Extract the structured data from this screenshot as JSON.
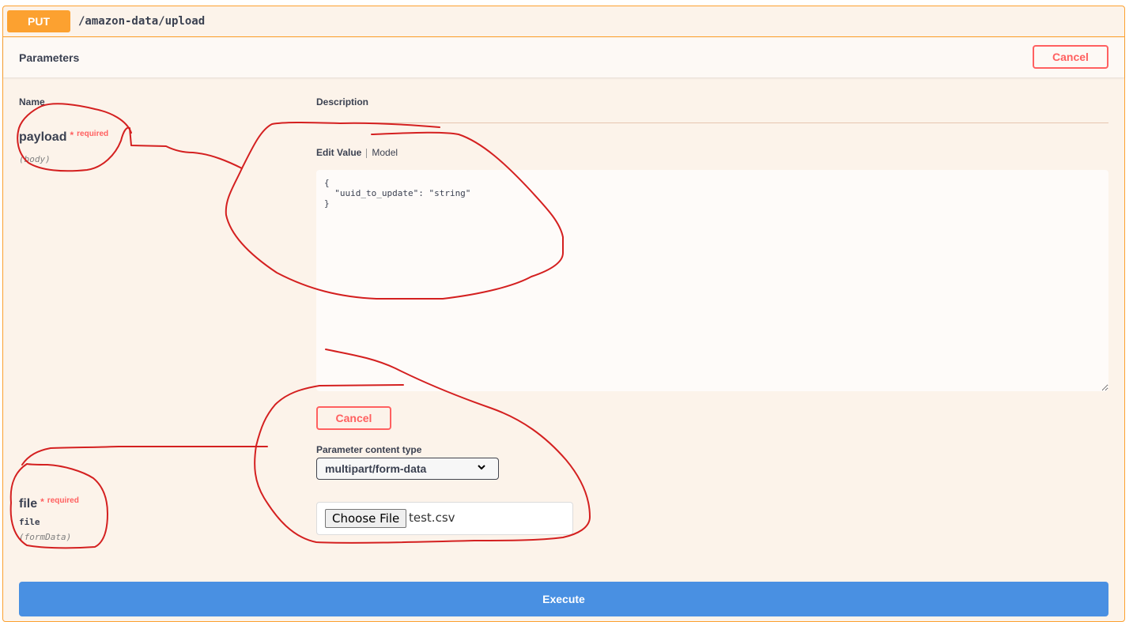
{
  "endpoint": {
    "method": "PUT",
    "path": "/amazon-data/upload"
  },
  "parameters_header": {
    "title": "Parameters",
    "cancel_label": "Cancel"
  },
  "columns": {
    "name": "Name",
    "description": "Description"
  },
  "params": [
    {
      "name": "payload",
      "star": "*",
      "required": "required",
      "type": "",
      "in": "(body)"
    },
    {
      "name": "file",
      "star": "*",
      "required": "required",
      "type": "file",
      "in": "(formData)"
    }
  ],
  "body_editor": {
    "tab_edit": "Edit Value",
    "tab_model": "Model",
    "value": "{\n  \"uuid_to_update\": \"string\"\n}",
    "cancel_label": "Cancel"
  },
  "content_type": {
    "label": "Parameter content type",
    "selected": "multipart/form-data"
  },
  "file_input": {
    "button_label": "Choose File",
    "file_name": "test.csv"
  },
  "execute_label": "Execute",
  "colors": {
    "put": "#fca130",
    "cancel": "#ff6060",
    "execute": "#4990e2",
    "annotation": "#d42020"
  }
}
